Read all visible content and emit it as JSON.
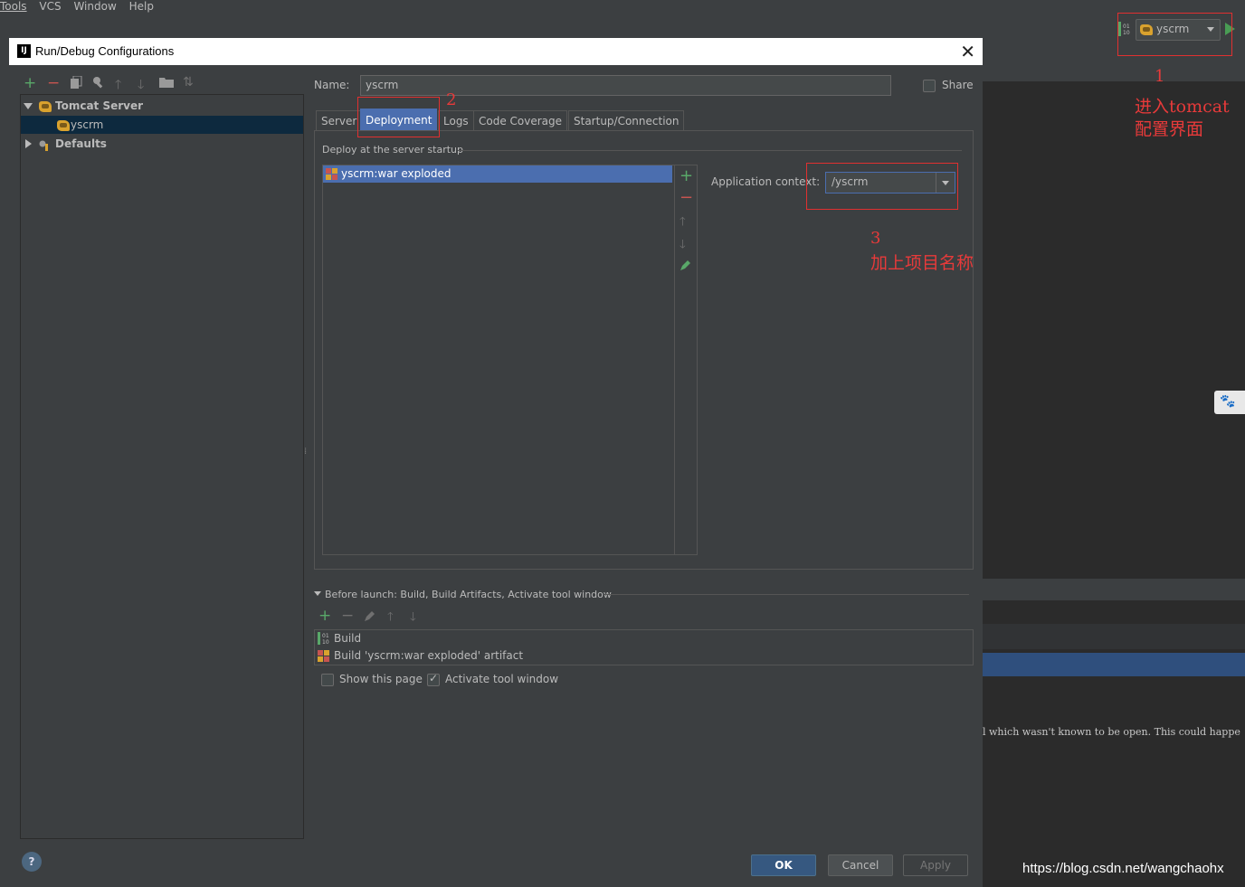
{
  "ide": {
    "menu": [
      "Tools",
      "VCS",
      "Window",
      "Help"
    ],
    "run_config_label": "yscrm",
    "console_text": "l which wasn't known to be open. This could happe"
  },
  "dialog": {
    "title": "Run/Debug Configurations",
    "tree": {
      "group": "Tomcat Server",
      "item": "yscrm",
      "defaults": "Defaults"
    },
    "name_label": "Name:",
    "name_value": "yscrm",
    "share_label": "Share",
    "share_checked": false,
    "tabs": [
      "Server",
      "Deployment",
      "Logs",
      "Code Coverage",
      "Startup/Connection"
    ],
    "active_tab": "Deployment",
    "deploy_section_label": "Deploy at the server startup",
    "deploy_items": [
      "yscrm:war exploded"
    ],
    "app_context_label": "Application context:",
    "app_context_value": "/yscrm",
    "before_launch_label": "Before launch: Build, Build Artifacts, Activate tool window",
    "before_launch_items": [
      "Build",
      "Build 'yscrm:war exploded' artifact"
    ],
    "show_page_label": "Show this page",
    "show_page_checked": false,
    "activate_label": "Activate tool window",
    "activate_checked": true,
    "ok_label": "OK",
    "cancel_label": "Cancel",
    "apply_label": "Apply",
    "help_label": "?"
  },
  "annotations": {
    "n1": "1",
    "t1_line1": "进入tomcat",
    "t1_line2": "配置界面",
    "n2": "2",
    "n3": "3",
    "t3": "加上项目名称"
  },
  "watermark": "https://blog.csdn.net/wangchaohx",
  "colors": {
    "annotation_red": "#e83a3a",
    "selection_blue": "#4b6eaf",
    "ok_blue": "#365880",
    "add_green": "#59a869",
    "remove_red": "#c75450"
  }
}
